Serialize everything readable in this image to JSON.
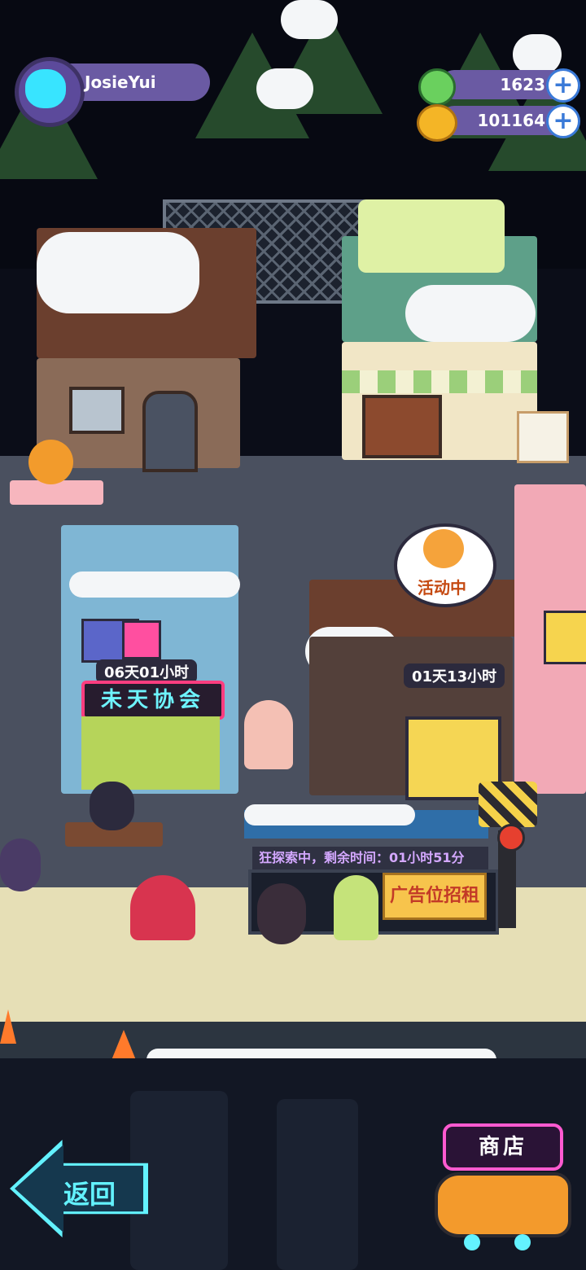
{
  "profile": {
    "username": "JosieYui"
  },
  "currencies": [
    {
      "icon": "green-gem-icon",
      "value": "1623"
    },
    {
      "icon": "gold-coin-icon",
      "value": "101164"
    }
  ],
  "buildings": {
    "association": {
      "timer": "06天01小时",
      "sign": "未天协会"
    },
    "shop_building": {
      "timer": "01天13小时",
      "event_label": "活动中"
    },
    "bus_stop": {
      "status": "狂探索中，剩余时间：01小时51分",
      "ad_sign": "广告位招租"
    }
  },
  "buttons": {
    "back": "返回",
    "shop": "商店"
  },
  "colors": {
    "accent": "#63f2ff",
    "shop_neon": "#ff5ad0",
    "profile_pill": "#6a5aa3"
  }
}
